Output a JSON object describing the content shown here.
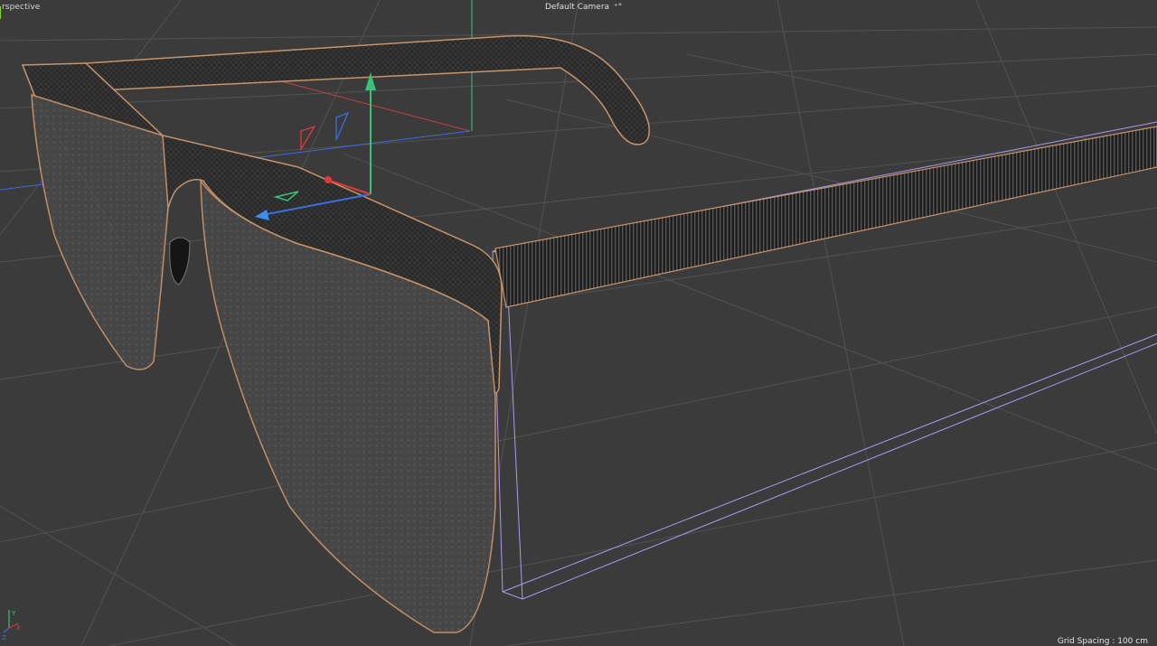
{
  "viewport": {
    "view_name": "Perspective",
    "view_name_visible": "rspective",
    "camera_name": "Default Camera",
    "camera_icon": "camera-link-icon",
    "grid_spacing_text": "Grid Spacing : 100 cm",
    "axis_labels": {
      "x": "X",
      "y": "Y",
      "z": "Z"
    }
  },
  "colors": {
    "background": "#3b3b3b",
    "grid": "#555555",
    "axis_x": "#e0393b",
    "axis_y": "#39c07a",
    "axis_z": "#3a6fe0",
    "selection": "#a89cf0",
    "frame_outline": "#c8946a"
  }
}
